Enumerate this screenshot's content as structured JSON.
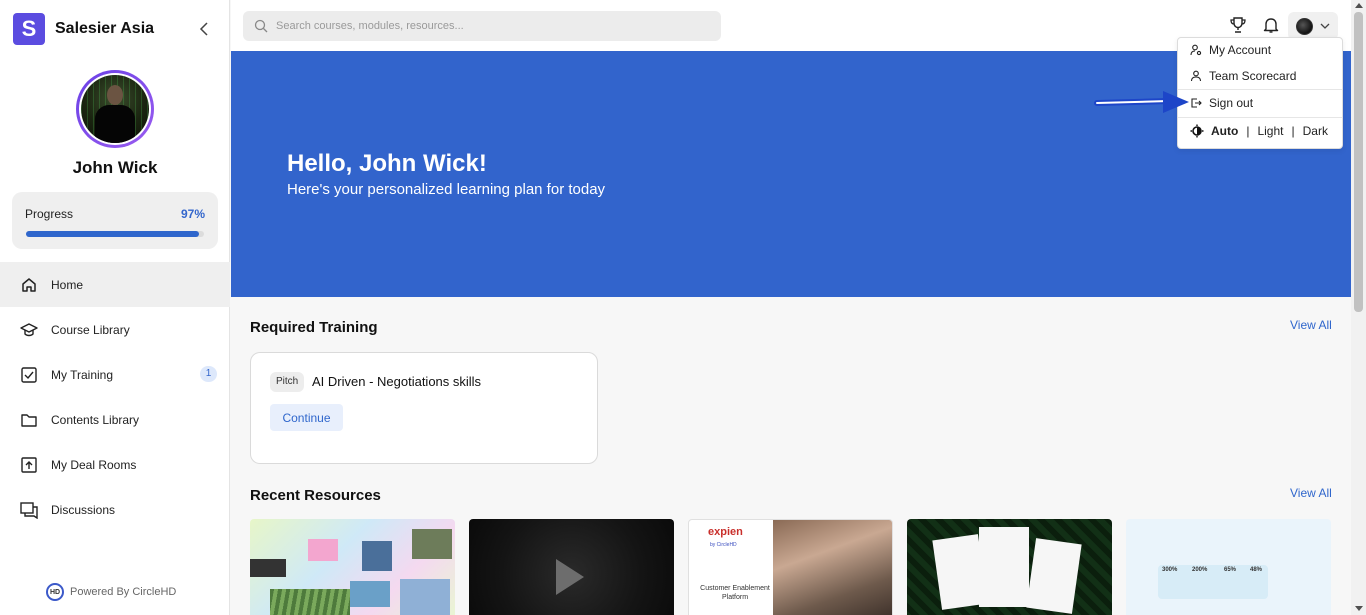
{
  "brand": {
    "logo_letter": "S",
    "name": "Salesier Asia",
    "accent": "#5b4ce0"
  },
  "user": {
    "name": "John Wick"
  },
  "progress": {
    "label": "Progress",
    "value": "97%",
    "fraction": 0.97
  },
  "nav": {
    "items": [
      {
        "label": "Home",
        "icon": "home-icon",
        "active": true
      },
      {
        "label": "Course Library",
        "icon": "graduation-cap-icon"
      },
      {
        "label": "My Training",
        "icon": "checklist-icon",
        "badge": "1"
      },
      {
        "label": "Contents Library",
        "icon": "folder-icon"
      },
      {
        "label": "My Deal Rooms",
        "icon": "upload-box-icon"
      },
      {
        "label": "Discussions",
        "icon": "chat-icon"
      }
    ]
  },
  "footer": {
    "powered_by": "Powered By CircleHD",
    "logo_text": "HD"
  },
  "search": {
    "placeholder": "Search courses, modules, resources..."
  },
  "hero": {
    "title": "Hello, John Wick!",
    "subtitle": "Here's your personalized learning plan for today",
    "color": "#3264cc"
  },
  "required_training": {
    "title": "Required Training",
    "view_all": "View All",
    "cards": [
      {
        "tag": "Pitch",
        "title": "AI Driven - Negotiations skills",
        "action": "Continue"
      }
    ]
  },
  "recent_resources": {
    "title": "Recent Resources",
    "view_all": "View All",
    "thumb3": {
      "brand": "expien",
      "sub": "by CircleHD",
      "caption": "Customer Enablement Platform"
    },
    "thumb5": {
      "stats": [
        "300%",
        "200%",
        "65%",
        "48%"
      ]
    }
  },
  "dropdown": {
    "items": [
      {
        "label": "My Account",
        "icon": "user-gear-icon"
      },
      {
        "label": "Team Scorecard",
        "icon": "user-icon"
      },
      {
        "label": "Sign out",
        "icon": "sign-out-icon"
      }
    ],
    "theme": {
      "options": [
        "Auto",
        "Light",
        "Dark"
      ],
      "selected": "Auto"
    }
  }
}
